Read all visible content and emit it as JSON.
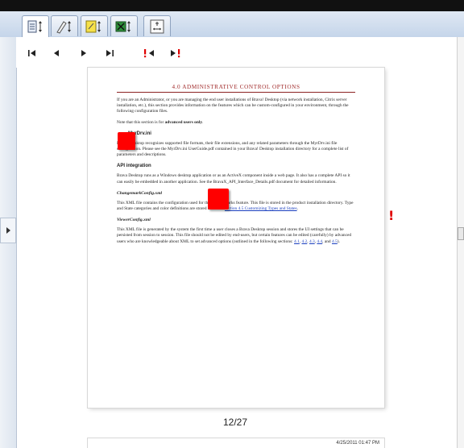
{
  "toolbar": {
    "tabs": [
      {
        "icon": "page-layout-icon"
      },
      {
        "icon": "pen-markup-icon"
      },
      {
        "icon": "sticky-note-icon"
      },
      {
        "icon": "stamp-icon"
      },
      {
        "icon": "measure-icon"
      }
    ]
  },
  "navigation": {
    "buttons": [
      {
        "icon": "first-page-icon"
      },
      {
        "icon": "previous-page-icon"
      },
      {
        "icon": "next-page-icon"
      },
      {
        "icon": "last-page-icon"
      },
      {
        "icon": "previous-markup-icon"
      },
      {
        "icon": "next-markup-icon"
      }
    ]
  },
  "document": {
    "title": "4.0   ADMINISTRATIVE CONTROL OPTIONS",
    "intro": "If you are an Administrator, or you are managing the end user installations of Brava! Desktop (via network installation, Citrix server installation, etc.), this section provides information on the features which can be custom-configured in your environment, through the following configuration files.",
    "note_prefix": "Note that this section is for ",
    "note_bold": "advanced users only",
    "note_suffix": ".",
    "myrdrv_heading": "MyrDrv.ini",
    "myrdrv_text": "Brava! Desktop recognizes supported file formats, their file extensions, and any related parameters through the MyrDrv.ini file configuration.  Please see the MyrDrv.ini UserGuide.pdf contained in your Brava! Desktop installation directory for a complete list of parameters and descriptions.",
    "api_heading": "API integration",
    "api_text": "Brava Desktop runs as a Windows desktop application or as an ActiveX component inside a web page. It also has a complete API so it can easily be embedded in another application. See the BravaX_API_Interface_Details.pdf document for detailed information.",
    "cm_heading": "ChangemarkConfig.xml",
    "cm_text": "This XML file contains the configuration used for the Changemarks feature. This file is stored in the product installation directory.  Type and State categories and color definitions are stored here. See ",
    "cm_link": "section 4.5 Customizing Types and States",
    "cm_end": ".",
    "viewer_heading": "ViewerConfig.xml",
    "viewer_text": "This XML file is generated by the system the first time a user closes a Brava Desktop session and stores the UI settings that can be persisted from session to session. This file should not be edited by end-users, but certain features can be edited (carefully) by advanced users who are knowledgeable about XML to set advanced options (outlined in the following sections: ",
    "viewer_links": [
      "4.1",
      "4.2",
      "4.3",
      "4.4",
      "4.5"
    ],
    "viewer_and": "and ",
    "viewer_end": ")."
  },
  "page_indicator": "12/27",
  "next_page_stamp": "4/25/2011 01:47 PM",
  "colors": {
    "markup_red": "#ff0000",
    "title_red": "#a02a2a",
    "link_blue": "#1a3fbf"
  }
}
